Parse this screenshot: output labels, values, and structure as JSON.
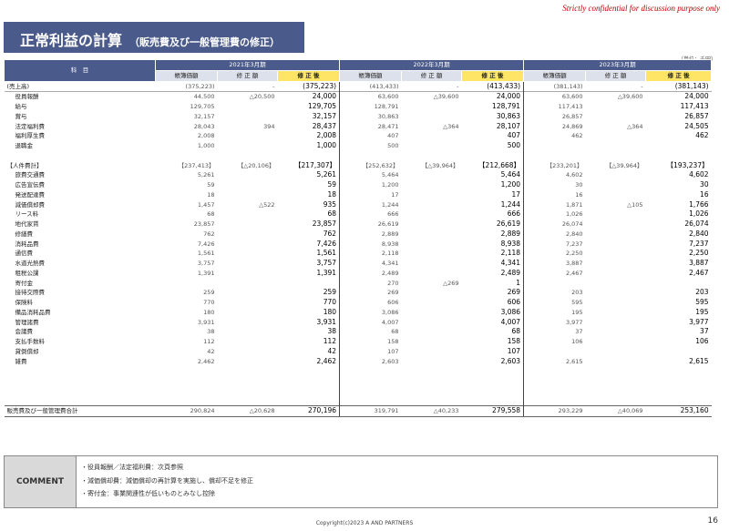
{
  "confidential": "Strictly confidential for discussion purpose only",
  "title": {
    "main": "正常利益の計算",
    "sub": "（販売費及び一般管理費の修正）"
  },
  "unit": "（単位：千円）",
  "header": {
    "item_col": "科　目",
    "periods": [
      "2021年3月期",
      "2022年3月期",
      "2023年3月期"
    ],
    "book": "帳簿価額",
    "adjust": "修 正 額",
    "after": "修 正 後"
  },
  "rows": [
    {
      "label": "(売上高)",
      "indent": false,
      "v": [
        "(375,223)",
        "-",
        "(375,223)",
        "(413,433)",
        "-",
        "(413,433)",
        "(381,143)",
        "-",
        "(381,143)"
      ]
    },
    {
      "label": "役員報酬",
      "indent": true,
      "v": [
        "44,500",
        "△20,500",
        "24,000",
        "63,600",
        "△39,600",
        "24,000",
        "63,600",
        "△39,600",
        "24,000"
      ]
    },
    {
      "label": "給与",
      "indent": true,
      "v": [
        "129,705",
        "",
        "129,705",
        "128,791",
        "",
        "128,791",
        "117,413",
        "",
        "117,413"
      ]
    },
    {
      "label": "賞与",
      "indent": true,
      "v": [
        "32,157",
        "",
        "32,157",
        "30,863",
        "",
        "30,863",
        "26,857",
        "",
        "26,857"
      ]
    },
    {
      "label": "法定福利費",
      "indent": true,
      "v": [
        "28,043",
        "394",
        "28,437",
        "28,471",
        "△364",
        "28,107",
        "24,869",
        "△364",
        "24,505"
      ]
    },
    {
      "label": "福利厚生費",
      "indent": true,
      "v": [
        "2,008",
        "",
        "2,008",
        "407",
        "",
        "407",
        "462",
        "",
        "462"
      ]
    },
    {
      "label": "退職金",
      "indent": true,
      "v": [
        "1,000",
        "",
        "1,000",
        "500",
        "",
        "500",
        "",
        "",
        ""
      ]
    },
    {
      "label": "",
      "indent": false,
      "v": [
        "",
        "",
        "",
        "",
        "",
        "",
        "",
        "",
        ""
      ]
    },
    {
      "label": "【人件費計】",
      "indent": false,
      "v": [
        "【237,413】",
        "【△20,106】",
        "【217,307】",
        "【252,632】",
        "【△39,964】",
        "【212,668】",
        "【233,201】",
        "【△39,964】",
        "【193,237】"
      ]
    },
    {
      "label": "旅費交通費",
      "indent": true,
      "v": [
        "5,261",
        "",
        "5,261",
        "5,464",
        "",
        "5,464",
        "4,602",
        "",
        "4,602"
      ]
    },
    {
      "label": "広告宣伝費",
      "indent": true,
      "v": [
        "59",
        "",
        "59",
        "1,200",
        "",
        "1,200",
        "30",
        "",
        "30"
      ]
    },
    {
      "label": "発送配達費",
      "indent": true,
      "v": [
        "18",
        "",
        "18",
        "17",
        "",
        "17",
        "16",
        "",
        "16"
      ]
    },
    {
      "label": "減価償却費",
      "indent": true,
      "v": [
        "1,457",
        "△522",
        "935",
        "1,244",
        "",
        "1,244",
        "1,871",
        "△105",
        "1,766"
      ]
    },
    {
      "label": "リース料",
      "indent": true,
      "v": [
        "68",
        "",
        "68",
        "666",
        "",
        "666",
        "1,026",
        "",
        "1,026"
      ]
    },
    {
      "label": "地代家賃",
      "indent": true,
      "v": [
        "23,857",
        "",
        "23,857",
        "26,619",
        "",
        "26,619",
        "26,074",
        "",
        "26,074"
      ]
    },
    {
      "label": "修繕費",
      "indent": true,
      "v": [
        "762",
        "",
        "762",
        "2,889",
        "",
        "2,889",
        "2,840",
        "",
        "2,840"
      ]
    },
    {
      "label": "消耗品費",
      "indent": true,
      "v": [
        "7,426",
        "",
        "7,426",
        "8,938",
        "",
        "8,938",
        "7,237",
        "",
        "7,237"
      ]
    },
    {
      "label": "通信費",
      "indent": true,
      "v": [
        "1,561",
        "",
        "1,561",
        "2,118",
        "",
        "2,118",
        "2,250",
        "",
        "2,250"
      ]
    },
    {
      "label": "水道光熱費",
      "indent": true,
      "v": [
        "3,757",
        "",
        "3,757",
        "4,341",
        "",
        "4,341",
        "3,887",
        "",
        "3,887"
      ]
    },
    {
      "label": "租税公課",
      "indent": true,
      "v": [
        "1,391",
        "",
        "1,391",
        "2,489",
        "",
        "2,489",
        "2,467",
        "",
        "2,467"
      ]
    },
    {
      "label": "寄付金",
      "indent": true,
      "v": [
        "",
        "",
        "",
        "270",
        "△269",
        "1",
        "",
        "",
        ""
      ]
    },
    {
      "label": "接待交際費",
      "indent": true,
      "v": [
        "259",
        "",
        "259",
        "269",
        "",
        "269",
        "203",
        "",
        "203"
      ]
    },
    {
      "label": "保険料",
      "indent": true,
      "v": [
        "770",
        "",
        "770",
        "606",
        "",
        "606",
        "595",
        "",
        "595"
      ]
    },
    {
      "label": "備品消耗品費",
      "indent": true,
      "v": [
        "180",
        "",
        "180",
        "3,086",
        "",
        "3,086",
        "195",
        "",
        "195"
      ]
    },
    {
      "label": "管理諸費",
      "indent": true,
      "v": [
        "3,931",
        "",
        "3,931",
        "4,007",
        "",
        "4,007",
        "3,977",
        "",
        "3,977"
      ]
    },
    {
      "label": "会議費",
      "indent": true,
      "v": [
        "38",
        "",
        "38",
        "68",
        "",
        "68",
        "37",
        "",
        "37"
      ]
    },
    {
      "label": "支払手数料",
      "indent": true,
      "v": [
        "112",
        "",
        "112",
        "158",
        "",
        "158",
        "106",
        "",
        "106"
      ]
    },
    {
      "label": "貸倒償却",
      "indent": true,
      "v": [
        "42",
        "",
        "42",
        "107",
        "",
        "107",
        "",
        "",
        ""
      ]
    },
    {
      "label": "雑費",
      "indent": true,
      "v": [
        "2,462",
        "",
        "2,462",
        "2,603",
        "",
        "2,603",
        "2,615",
        "",
        "2,615"
      ]
    },
    {
      "label": "",
      "indent": false,
      "v": [
        "",
        "",
        "",
        "",
        "",
        "",
        "",
        "",
        ""
      ]
    },
    {
      "label": "",
      "indent": false,
      "v": [
        "",
        "",
        "",
        "",
        "",
        "",
        "",
        "",
        ""
      ]
    },
    {
      "label": "",
      "indent": false,
      "v": [
        "",
        "",
        "",
        "",
        "",
        "",
        "",
        "",
        ""
      ]
    },
    {
      "label": "",
      "indent": false,
      "v": [
        "",
        "",
        "",
        "",
        "",
        "",
        "",
        "",
        ""
      ]
    }
  ],
  "total": {
    "label": "販売費及び一般管理費合計",
    "v": [
      "290,824",
      "△20,628",
      "270,196",
      "319,791",
      "△40,233",
      "279,558",
      "293,229",
      "△40,069",
      "253,160"
    ]
  },
  "comment": {
    "label": "COMMENT",
    "lines": [
      "・役員報酬／法定福利費：次頁参照",
      "・減価償却費：減価償却の再計算を実施し、償却不足を修正",
      "・寄付金：事業関連性が低いものとみなし控除"
    ]
  },
  "footer": "Copyright(c)2023  A AND PARTNERS",
  "page_number": "16",
  "colors": {
    "header_blue": "#4a5a8a",
    "subheader_gray": "#dde1eb",
    "highlight_yellow": "#ffe566",
    "confidential_red": "#c00000"
  }
}
